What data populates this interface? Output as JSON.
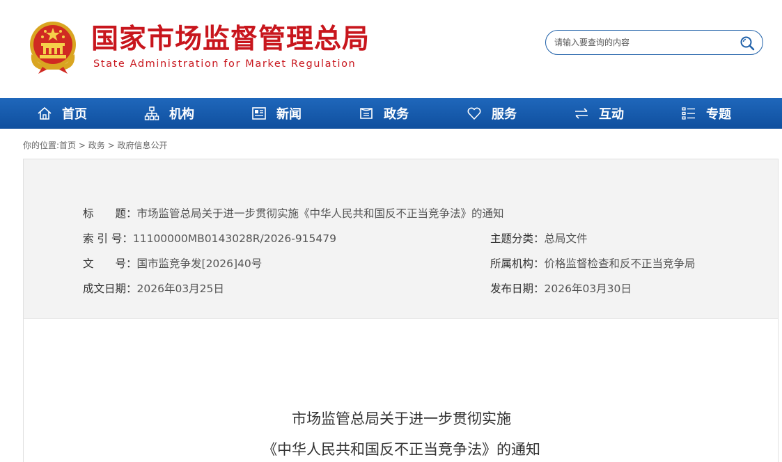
{
  "header": {
    "title_cn": "国家市场监督管理总局",
    "title_en": "State Administration for Market Regulation",
    "emblem_icon": "national-emblem-icon",
    "brand_color": "#c8161d"
  },
  "search": {
    "placeholder": "请输入要查询的内容",
    "icon": "search-icon",
    "border_color": "#1d5fa8"
  },
  "nav": {
    "background": "#1660b0",
    "items": [
      {
        "label": "首页",
        "icon": "home-icon"
      },
      {
        "label": "机构",
        "icon": "org-chart-icon"
      },
      {
        "label": "新闻",
        "icon": "newspaper-icon"
      },
      {
        "label": "政务",
        "icon": "document-icon"
      },
      {
        "label": "服务",
        "icon": "heart-icon"
      },
      {
        "label": "互动",
        "icon": "exchange-icon"
      },
      {
        "label": "专题",
        "icon": "list-icon"
      }
    ]
  },
  "breadcrumb": {
    "prefix": "你的位置:",
    "items": [
      "首页",
      "政务",
      "政府信息公开"
    ],
    "separator": " > "
  },
  "info": {
    "title_label": "标　　题：",
    "title_value": "市场监管总局关于进一步贯彻实施《中华人民共和国反不正当竞争法》的通知",
    "index_label": "索 引 号：",
    "index_value": "11100000MB0143028R/2026-915479",
    "category_label": "主题分类：",
    "category_value": "总局文件",
    "docno_label": "文　　号：",
    "docno_value": "国市监竞争发[2026]40号",
    "dept_label": "所属机构：",
    "dept_value": "价格监督检查和反不正当竞争局",
    "created_label": "成文日期：",
    "created_value": "2026年03月25日",
    "published_label": "发布日期：",
    "published_value": "2026年03月30日"
  },
  "document": {
    "title_line1": "市场监管总局关于进一步贯彻实施",
    "title_line2": "《中华人民共和国反不正当竞争法》的通知"
  }
}
